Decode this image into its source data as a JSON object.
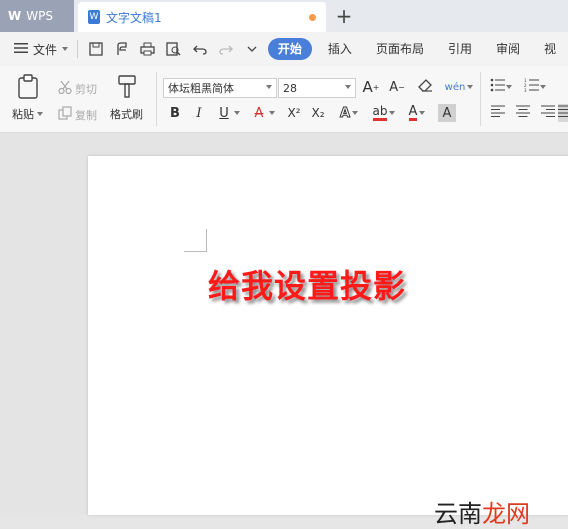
{
  "app": {
    "name": "WPS",
    "doc_tab": "文字文稿1",
    "new_tab": "+"
  },
  "menu": {
    "file": "文件",
    "tabs": [
      "开始",
      "插入",
      "页面布局",
      "引用",
      "审阅",
      "视"
    ]
  },
  "ribbon": {
    "paste": "粘贴",
    "cut": "剪切",
    "copy": "复制",
    "format_painter": "格式刷",
    "font_name": "体坛粗黑简体",
    "font_size": "28",
    "bold": "B",
    "italic": "I",
    "underline": "U",
    "strike": "A",
    "superscript": "X²",
    "subscript": "X₂",
    "text_effect": "A",
    "highlight": "ab",
    "font_color": "A",
    "char_shade": "A",
    "phonetic": "wén",
    "grow_font": "A",
    "shrink_font": "A"
  },
  "document": {
    "text": "给我设置投影",
    "text_color": "#ff1a1a"
  },
  "watermark": {
    "part1": "云南",
    "part2": "龙网"
  },
  "colors": {
    "accent": "#4a7fd9",
    "tab_dot": "#f59a4b"
  }
}
